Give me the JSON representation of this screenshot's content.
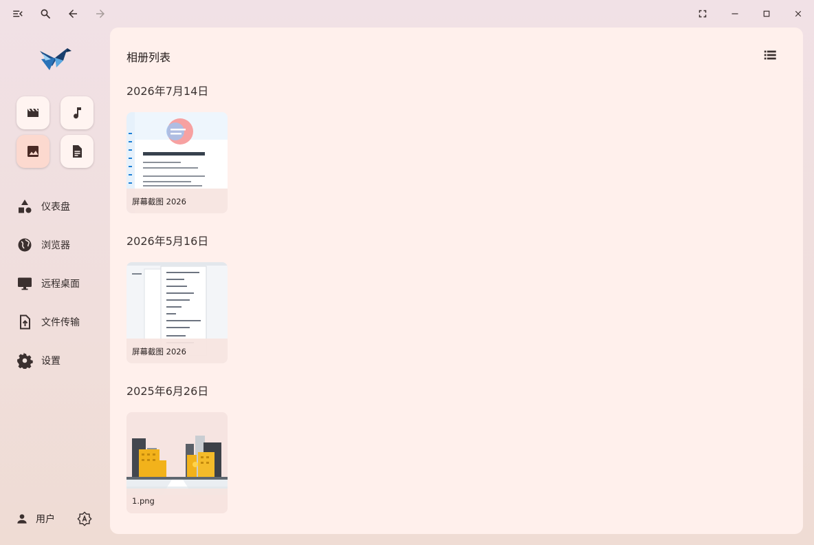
{
  "page": {
    "title": "相册列表"
  },
  "sidebar": {
    "quick_actions": [
      {
        "name": "videos",
        "icon": "movie-icon",
        "active": false
      },
      {
        "name": "music",
        "icon": "music-note-icon",
        "active": false
      },
      {
        "name": "photos",
        "icon": "image-icon",
        "active": true
      },
      {
        "name": "documents",
        "icon": "document-icon",
        "active": false
      }
    ],
    "nav": [
      {
        "label": "仪表盘",
        "icon": "dashboard-shapes-icon"
      },
      {
        "label": "浏览器",
        "icon": "globe-icon"
      },
      {
        "label": "远程桌面",
        "icon": "monitor-icon"
      },
      {
        "label": "文件传输",
        "icon": "file-upload-icon"
      },
      {
        "label": "设置",
        "icon": "gear-icon"
      }
    ],
    "user_label": "用户"
  },
  "groups": [
    {
      "date": "2026年7月14日",
      "items": [
        {
          "caption": "屏幕截图 2026"
        }
      ]
    },
    {
      "date": "2026年5月16日",
      "items": [
        {
          "caption": "屏幕截图 2026"
        }
      ]
    },
    {
      "date": "2025年6月26日",
      "items": [
        {
          "caption": "1.png"
        }
      ]
    }
  ],
  "colors": {
    "accent": "#fcd9cf",
    "surface": "#fff0ec",
    "icon": "#3b302f"
  }
}
